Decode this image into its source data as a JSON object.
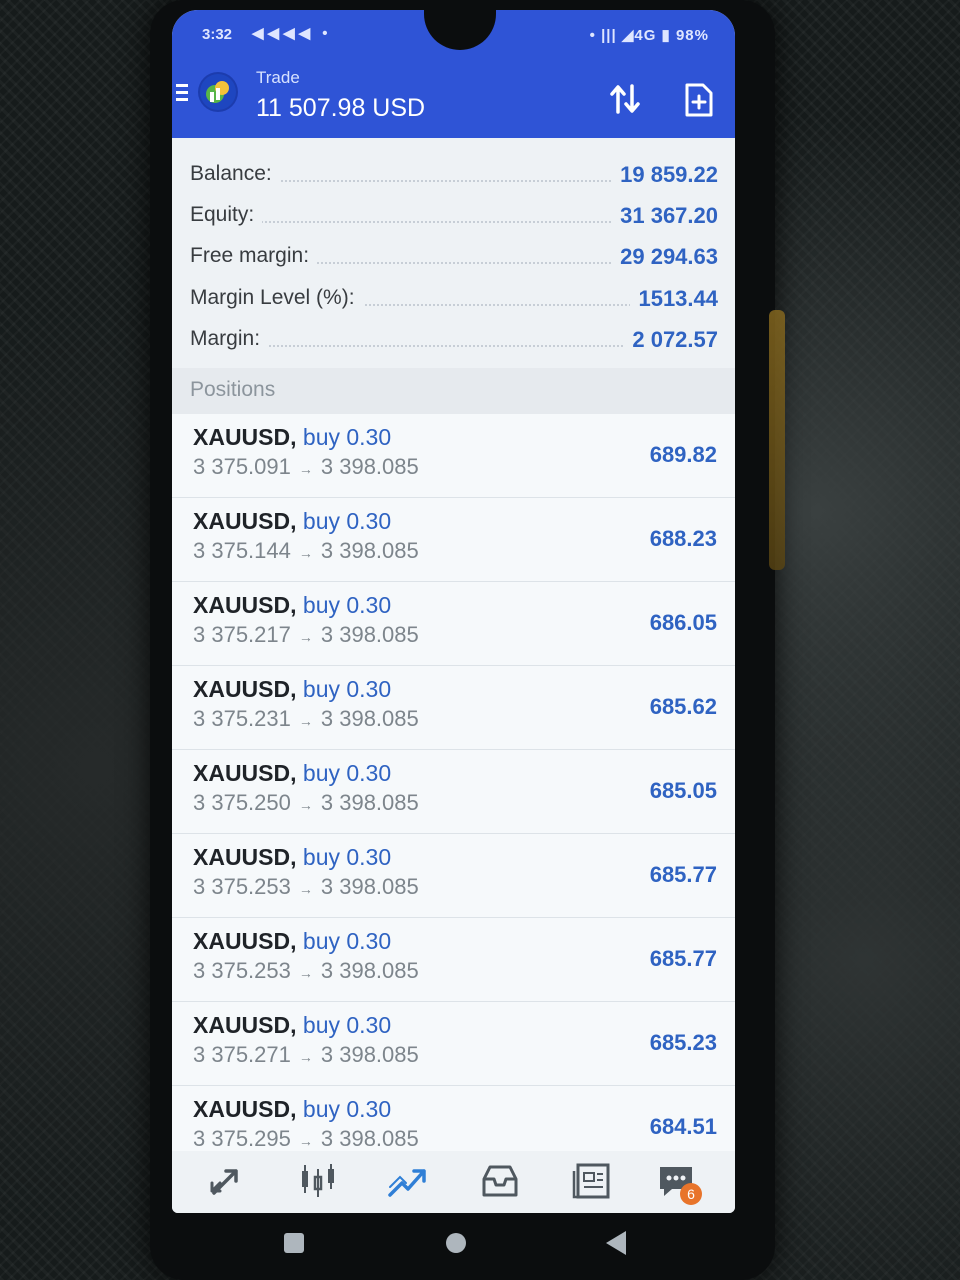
{
  "status_bar": {
    "time": "3:32",
    "notifications": "◀◀◀◀ •",
    "right": "• ||| ◢4G ▮ 98%"
  },
  "header": {
    "title": "Trade",
    "balance": "11 507.98 USD"
  },
  "summary": [
    {
      "label": "Balance:",
      "value": "19 859.22"
    },
    {
      "label": "Equity:",
      "value": "31 367.20"
    },
    {
      "label": "Free margin:",
      "value": "29 294.63"
    },
    {
      "label": "Margin Level (%):",
      "value": "1513.44"
    },
    {
      "label": "Margin:",
      "value": "2 072.57"
    }
  ],
  "positions_header": "Positions",
  "positions": [
    {
      "symbol": "XAUUSD,",
      "direction": "buy 0.30",
      "open": "3 375.091",
      "current": "3 398.085",
      "profit": "689.82"
    },
    {
      "symbol": "XAUUSD,",
      "direction": "buy 0.30",
      "open": "3 375.144",
      "current": "3 398.085",
      "profit": "688.23"
    },
    {
      "symbol": "XAUUSD,",
      "direction": "buy 0.30",
      "open": "3 375.217",
      "current": "3 398.085",
      "profit": "686.05"
    },
    {
      "symbol": "XAUUSD,",
      "direction": "buy 0.30",
      "open": "3 375.231",
      "current": "3 398.085",
      "profit": "685.62"
    },
    {
      "symbol": "XAUUSD,",
      "direction": "buy 0.30",
      "open": "3 375.250",
      "current": "3 398.085",
      "profit": "685.05"
    },
    {
      "symbol": "XAUUSD,",
      "direction": "buy 0.30",
      "open": "3 375.253",
      "current": "3 398.085",
      "profit": "685.77"
    },
    {
      "symbol": "XAUUSD,",
      "direction": "buy 0.30",
      "open": "3 375.253",
      "current": "3 398.085",
      "profit": "685.77"
    },
    {
      "symbol": "XAUUSD,",
      "direction": "buy 0.30",
      "open": "3 375.271",
      "current": "3 398.085",
      "profit": "685.23"
    },
    {
      "symbol": "XAUUSD,",
      "direction": "buy 0.30",
      "open": "3 375.295",
      "current": "3 398.085",
      "profit": "684.51"
    }
  ],
  "bottom_nav": {
    "items": [
      "quotes-icon",
      "chart-icon",
      "trade-icon",
      "history-icon",
      "news-icon",
      "chat-icon"
    ],
    "chat_badge": "6",
    "active_color": "#2f63c2"
  },
  "colors": {
    "appbar": "#2f54d6",
    "accent_blue": "#2f63c2",
    "badge": "#e8742a"
  }
}
